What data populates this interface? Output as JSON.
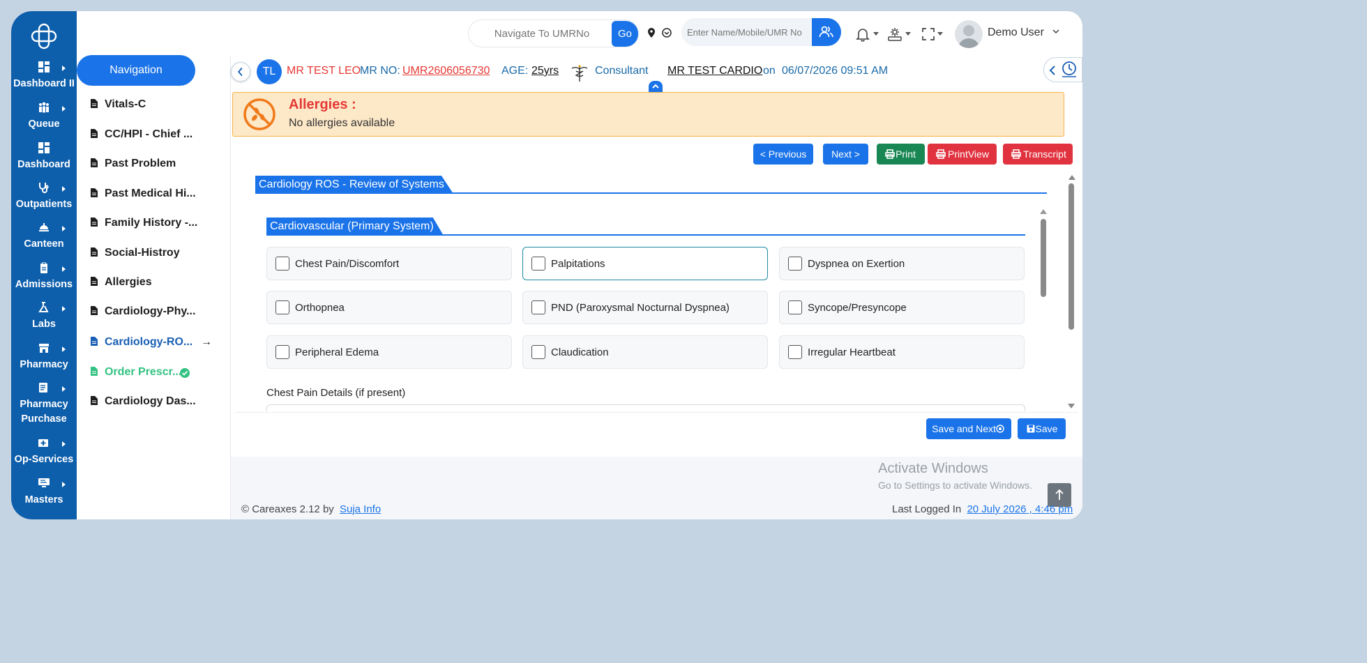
{
  "rail": {
    "items": [
      {
        "label": "Dashboard II",
        "icon": "dashboard-icon"
      },
      {
        "label": "Queue",
        "icon": "people-icon"
      },
      {
        "label": "Dashboard",
        "icon": "dashboard-icon"
      },
      {
        "label": "Outpatients",
        "icon": "stethoscope-icon"
      },
      {
        "label": "Canteen",
        "icon": "food-tray-icon"
      },
      {
        "label": "Admissions",
        "icon": "clipboard-icon"
      },
      {
        "label": "Labs",
        "icon": "flask-icon"
      },
      {
        "label": "Pharmacy",
        "icon": "store-icon"
      },
      {
        "label": "Pharmacy Purchase",
        "icon": "invoice-icon"
      },
      {
        "label": "Op-Services",
        "icon": "medical-kit-icon"
      },
      {
        "label": "Masters",
        "icon": "monitor-icon"
      }
    ]
  },
  "nav": {
    "title": "Navigation",
    "items": [
      {
        "label": "Vitals-C",
        "state": "normal"
      },
      {
        "label": "CC/HPI - Chief ...",
        "state": "normal"
      },
      {
        "label": "Past Problem",
        "state": "normal"
      },
      {
        "label": "Past Medical Hi...",
        "state": "normal"
      },
      {
        "label": "Family History -...",
        "state": "normal"
      },
      {
        "label": "Social-Histroy",
        "state": "normal"
      },
      {
        "label": "Allergies",
        "state": "normal"
      },
      {
        "label": "Cardiology-Phy...",
        "state": "normal"
      },
      {
        "label": "Cardiology-RO...",
        "state": "active"
      },
      {
        "label": "Order Prescr...",
        "state": "done"
      },
      {
        "label": "Cardiology Das...",
        "state": "normal"
      }
    ],
    "active_arrow": "→"
  },
  "header": {
    "umr_placeholder": "Navigate To UMRNo",
    "go_label": "Go",
    "search_placeholder": "Enter Name/Mobile/UMR No",
    "user_name": "Demo User"
  },
  "patient": {
    "initials": "TL",
    "name": "MR TEST LEO",
    "mr_label": "MR NO:",
    "mr_no": "UMR2606056730",
    "age_label": "AGE:",
    "age": "25yrs",
    "consultant_label": "Consultant",
    "consultant": "MR TEST CARDIO",
    "on_label": "on",
    "datetime": "06/07/2026 09:51 AM"
  },
  "allergies": {
    "title": "Allergies :",
    "text": "No allergies available"
  },
  "toolbar": {
    "previous": "< Previous",
    "next": "Next >",
    "print": "Print",
    "printview": "PrintView",
    "transcript": "Transcript"
  },
  "form": {
    "section_title": "Cardiology ROS - Review of Systems",
    "subsection_title": "Cardiovascular (Primary System)",
    "checkboxes": [
      "Chest Pain/Discomfort",
      "Palpitations",
      "Dyspnea on Exertion",
      "Orthopnea",
      "PND (Paroxysmal Nocturnal Dyspnea)",
      "Syncope/Presyncope",
      "Peripheral Edema",
      "Claudication",
      "Irregular Heartbeat"
    ],
    "details_label": "Chest Pain Details (if present)",
    "save_next": "Save and Next",
    "save": "Save"
  },
  "watermark": {
    "line1": "Activate Windows",
    "line2": "Go to Settings to activate Windows."
  },
  "footer": {
    "copyright": "© Careaxes 2.12 by",
    "company": "Suja Info",
    "last_logged_label": "Last Logged In",
    "last_logged_value": "20 July 2026 , 4:46 pm"
  },
  "colors": {
    "rail": "#0d5eab",
    "primary": "#1a73e8",
    "danger": "#e0323f",
    "success": "#198754",
    "done": "#33c281"
  }
}
